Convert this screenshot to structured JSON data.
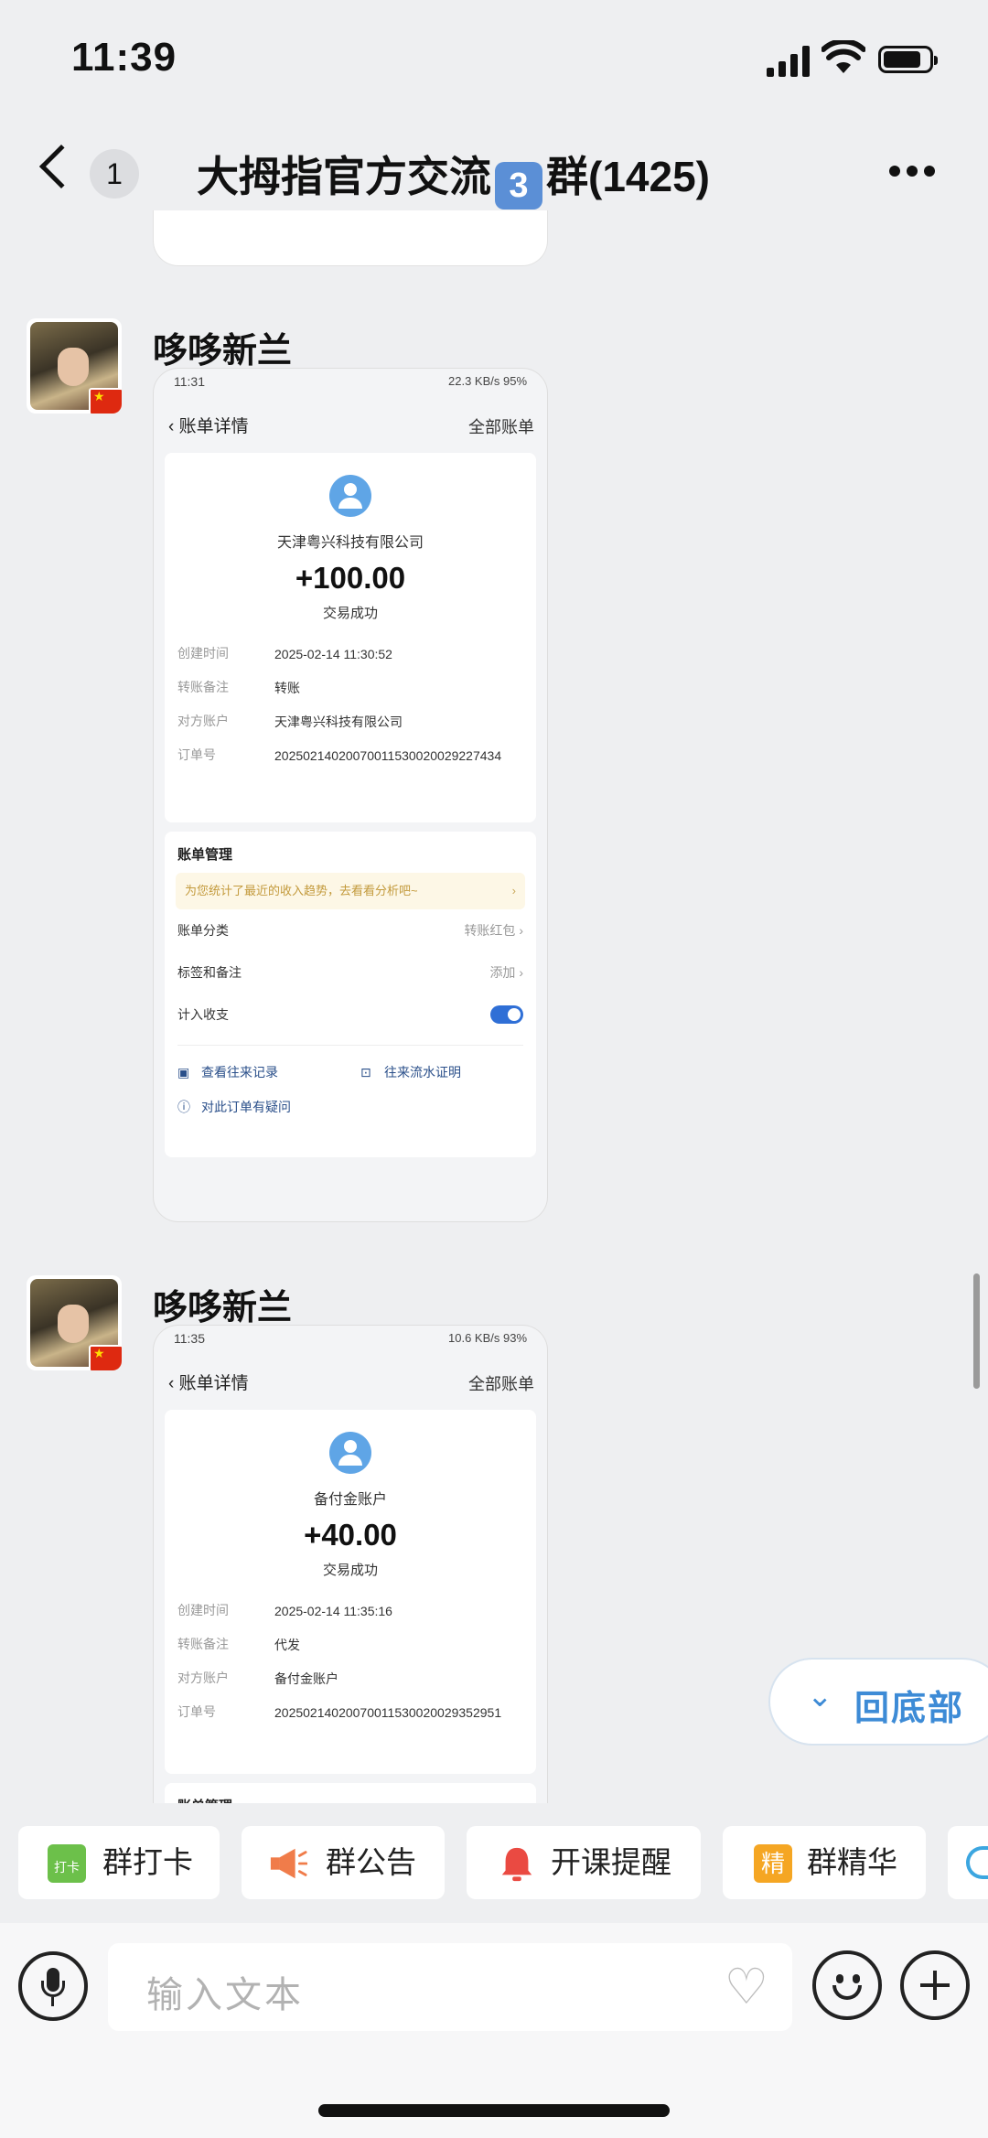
{
  "status_bar": {
    "time": "11:39"
  },
  "header": {
    "unread_count": "1",
    "title_pre": "大拇指官方交流",
    "title_keycap": "3",
    "title_post": "群(1425)"
  },
  "messages": [
    {
      "sender": "哆哆新兰",
      "screenshot": {
        "status_time": "11:31",
        "status_right": "22.3 KB/s  95%",
        "nav_title": "账单详情",
        "nav_right": "全部账单",
        "payee": "天津粤兴科技有限公司",
        "amount": "+100.00",
        "tx_status": "交易成功",
        "details": [
          {
            "key": "创建时间",
            "value": "2025-02-14 11:30:52"
          },
          {
            "key": "转账备注",
            "value": "转账"
          },
          {
            "key": "对方账户",
            "value": "天津粤兴科技有限公司"
          },
          {
            "key": "订单号",
            "value": "20250214020070011530020029227434"
          }
        ],
        "mgmt_title": "账单管理",
        "hint": "为您统计了最近的收入趋势，去看看分析吧~",
        "category_label": "账单分类",
        "category_value": "转账红包",
        "tags_label": "标签和备注",
        "tags_value": "添加",
        "count_label": "计入收支",
        "link_records": "查看往来记录",
        "link_proof": "往来流水证明",
        "link_question": "对此订单有疑问"
      }
    },
    {
      "sender": "哆哆新兰",
      "screenshot": {
        "status_time": "11:35",
        "status_right": "10.6 KB/s  93%",
        "nav_title": "账单详情",
        "nav_right": "全部账单",
        "payee": "备付金账户",
        "amount": "+40.00",
        "tx_status": "交易成功",
        "details": [
          {
            "key": "创建时间",
            "value": "2025-02-14 11:35:16"
          },
          {
            "key": "转账备注",
            "value": "代发"
          },
          {
            "key": "对方账户",
            "value": "备付金账户"
          },
          {
            "key": "订单号",
            "value": "20250214020070011530020029352951"
          }
        ],
        "mgmt_title": "账单管理"
      }
    }
  ],
  "scroll_to_bottom": {
    "label": "回底部"
  },
  "quick_actions": [
    {
      "label": "群打卡",
      "icon": "checkin-calendar-icon",
      "icon_text": "打卡"
    },
    {
      "label": "群公告",
      "icon": "megaphone-icon"
    },
    {
      "label": "开课提醒",
      "icon": "bell-icon"
    },
    {
      "label": "群精华",
      "icon": "essence-icon",
      "icon_text": "精"
    }
  ],
  "composer": {
    "placeholder": "输入文本"
  },
  "colors": {
    "accent": "#3d8bd6",
    "background": "#eeeff1"
  }
}
